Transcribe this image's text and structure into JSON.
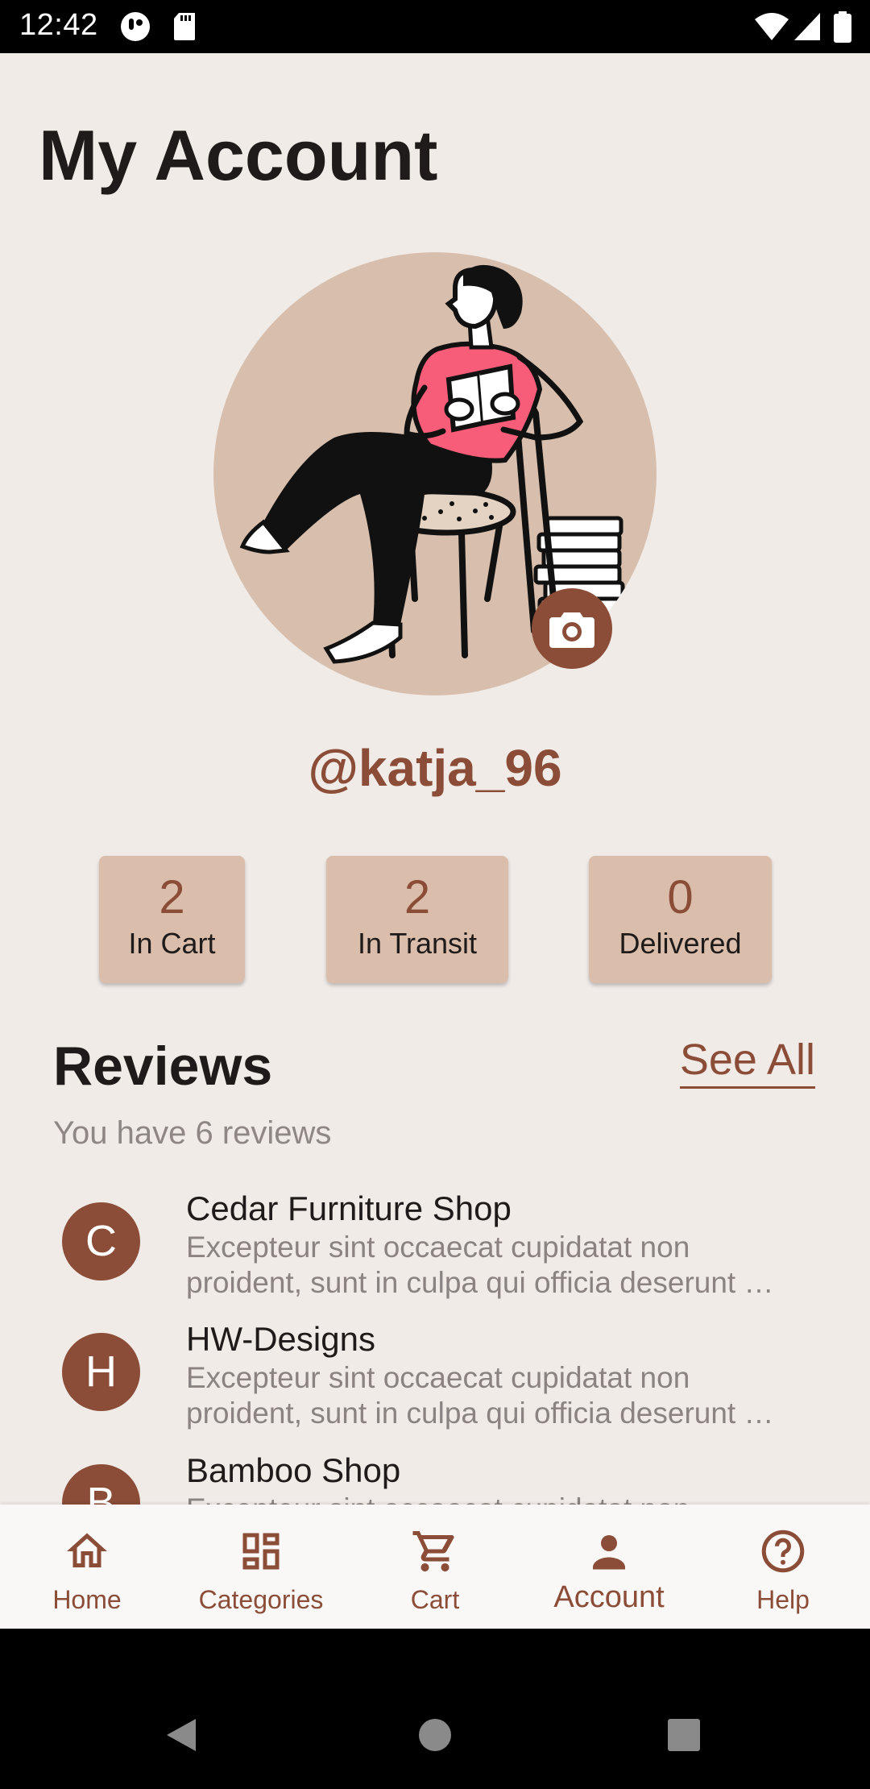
{
  "status_bar": {
    "time": "12:42",
    "icons": [
      "notification-app-icon",
      "sd-card-icon",
      "wifi-icon",
      "signal-icon",
      "battery-icon"
    ]
  },
  "page": {
    "title": "My Account"
  },
  "profile": {
    "username": "@katja_96",
    "avatar": "reading-person-illustration",
    "camera_icon": "camera-icon"
  },
  "stats": [
    {
      "value": "2",
      "label": "In Cart"
    },
    {
      "value": "2",
      "label": "In Transit"
    },
    {
      "value": "0",
      "label": "Delivered"
    }
  ],
  "reviews": {
    "title": "Reviews",
    "see_all": "See All",
    "count_text": "You have 6 reviews",
    "items": [
      {
        "initial": "C",
        "name": "Cedar Furniture Shop",
        "text": "Excepteur sint occaecat cupidatat non proident, sunt in culpa qui officia deserunt …"
      },
      {
        "initial": "H",
        "name": "HW-Designs",
        "text": "Excepteur sint occaecat cupidatat non proident, sunt in culpa qui officia deserunt …"
      },
      {
        "initial": "B",
        "name": "Bamboo Shop",
        "text": "Excepteur sint occaecat cupidatat non proident, sunt in culpa qui officia deserunt …"
      }
    ]
  },
  "bottom_nav": {
    "items": [
      {
        "label": "Home",
        "icon": "home-icon"
      },
      {
        "label": "Categories",
        "icon": "categories-icon"
      },
      {
        "label": "Cart",
        "icon": "cart-icon"
      },
      {
        "label": "Account",
        "icon": "account-icon",
        "active": true
      },
      {
        "label": "Help",
        "icon": "help-icon"
      }
    ]
  },
  "colors": {
    "accent": "#8b4d37",
    "background": "#f1ebe8",
    "card": "#dabeab",
    "avatar_bg": "#d8bfad",
    "shirt": "#f75c78"
  }
}
